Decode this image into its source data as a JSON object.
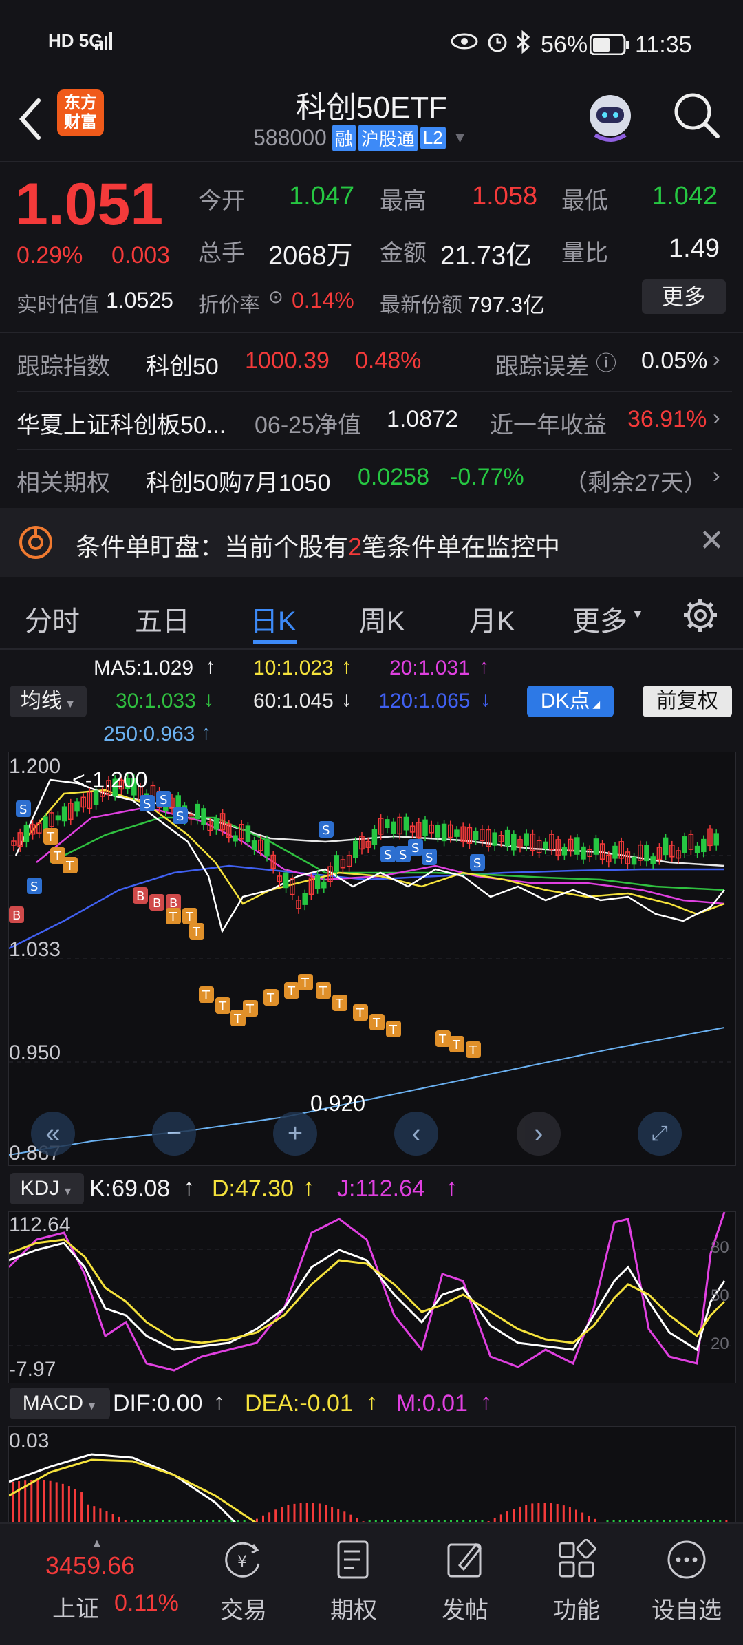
{
  "status_bar": {
    "network": "HD 5G",
    "battery": "56%",
    "time": "11:35"
  },
  "header": {
    "title": "科创50ETF",
    "code": "588000",
    "badges": [
      "融",
      "沪股通",
      "L2"
    ],
    "logo_text": "东方\n财富"
  },
  "quote": {
    "price": "1.051",
    "change_pct": "0.29%",
    "change": "0.003",
    "open_label": "今开",
    "open": "1.047",
    "high_label": "最高",
    "high": "1.058",
    "low_label": "最低",
    "low": "1.042",
    "volume_label": "总手",
    "volume": "2068万",
    "amount_label": "金额",
    "amount": "21.73亿",
    "ratio_label": "量比",
    "ratio": "1.49",
    "iopv_label": "实时估值",
    "iopv": "1.0525",
    "discount_label": "折价率",
    "discount": "0.14%",
    "shares_label": "最新份额",
    "shares": "797.3亿",
    "more": "更多"
  },
  "info_rows": {
    "track_label": "跟踪指数",
    "track_name": "科创50",
    "track_value": "1000.39",
    "track_pct": "0.48%",
    "err_label": "跟踪误差",
    "err_value": "0.05%",
    "fund_name": "华夏上证科创板50...",
    "nav_date": "06-25净值",
    "nav": "1.0872",
    "yr_label": "近一年收益",
    "yr_value": "36.91%",
    "opt_label": "相关期权",
    "opt_name": "科创50购7月1050",
    "opt_price": "0.0258",
    "opt_pct": "-0.77%",
    "opt_left": "（剩余27天）"
  },
  "banner": {
    "text_a": "条件单盯盘：当前个股有",
    "count": "2",
    "text_b": "笔条件单在监控中"
  },
  "tabs": [
    "分时",
    "五日",
    "日K",
    "周K",
    "月K",
    "更多"
  ],
  "ma": {
    "ma5": "MA5:1.029",
    "ma10": "10:1.023",
    "ma20": "20:1.031",
    "ma30": "30:1.033",
    "ma60": "60:1.045",
    "ma120": "120:1.065",
    "ma250": "250:0.963",
    "junxian": "均线",
    "dk": "DK点",
    "fq": "前复权"
  },
  "price_chart": {
    "y_top": "1.200",
    "y_mid1": "1.033",
    "y_mid2": "0.950",
    "y_bottom": "0.867",
    "max_note": "<-1.200",
    "min_note": "0.920"
  },
  "kdj": {
    "label": "KDJ",
    "k": "K:69.08",
    "d": "D:47.30",
    "j": "J:112.64",
    "top": "112.64",
    "bottom": "-7.97",
    "r80": "80",
    "r50": "50",
    "r20": "20"
  },
  "macd": {
    "label": "MACD",
    "dif": "DIF:0.00",
    "dea": "DEA:-0.01",
    "m": "M:0.01",
    "top": "0.03"
  },
  "bottom_nav": {
    "index_value": "3459.66",
    "index_name": "上证",
    "index_pct": "0.11%",
    "items": [
      "交易",
      "期权",
      "发帖",
      "功能",
      "设自选"
    ]
  },
  "colors": {
    "up": "#f43a3a",
    "down": "#26c742",
    "accent": "#3d8af7",
    "ma5": "#ffffff",
    "ma10": "#f5e23c",
    "ma20": "#e040e0",
    "ma30": "#30c040",
    "ma60": "#e8e8e8",
    "ma120": "#4060f0",
    "ma250": "#6ab0f0"
  }
}
